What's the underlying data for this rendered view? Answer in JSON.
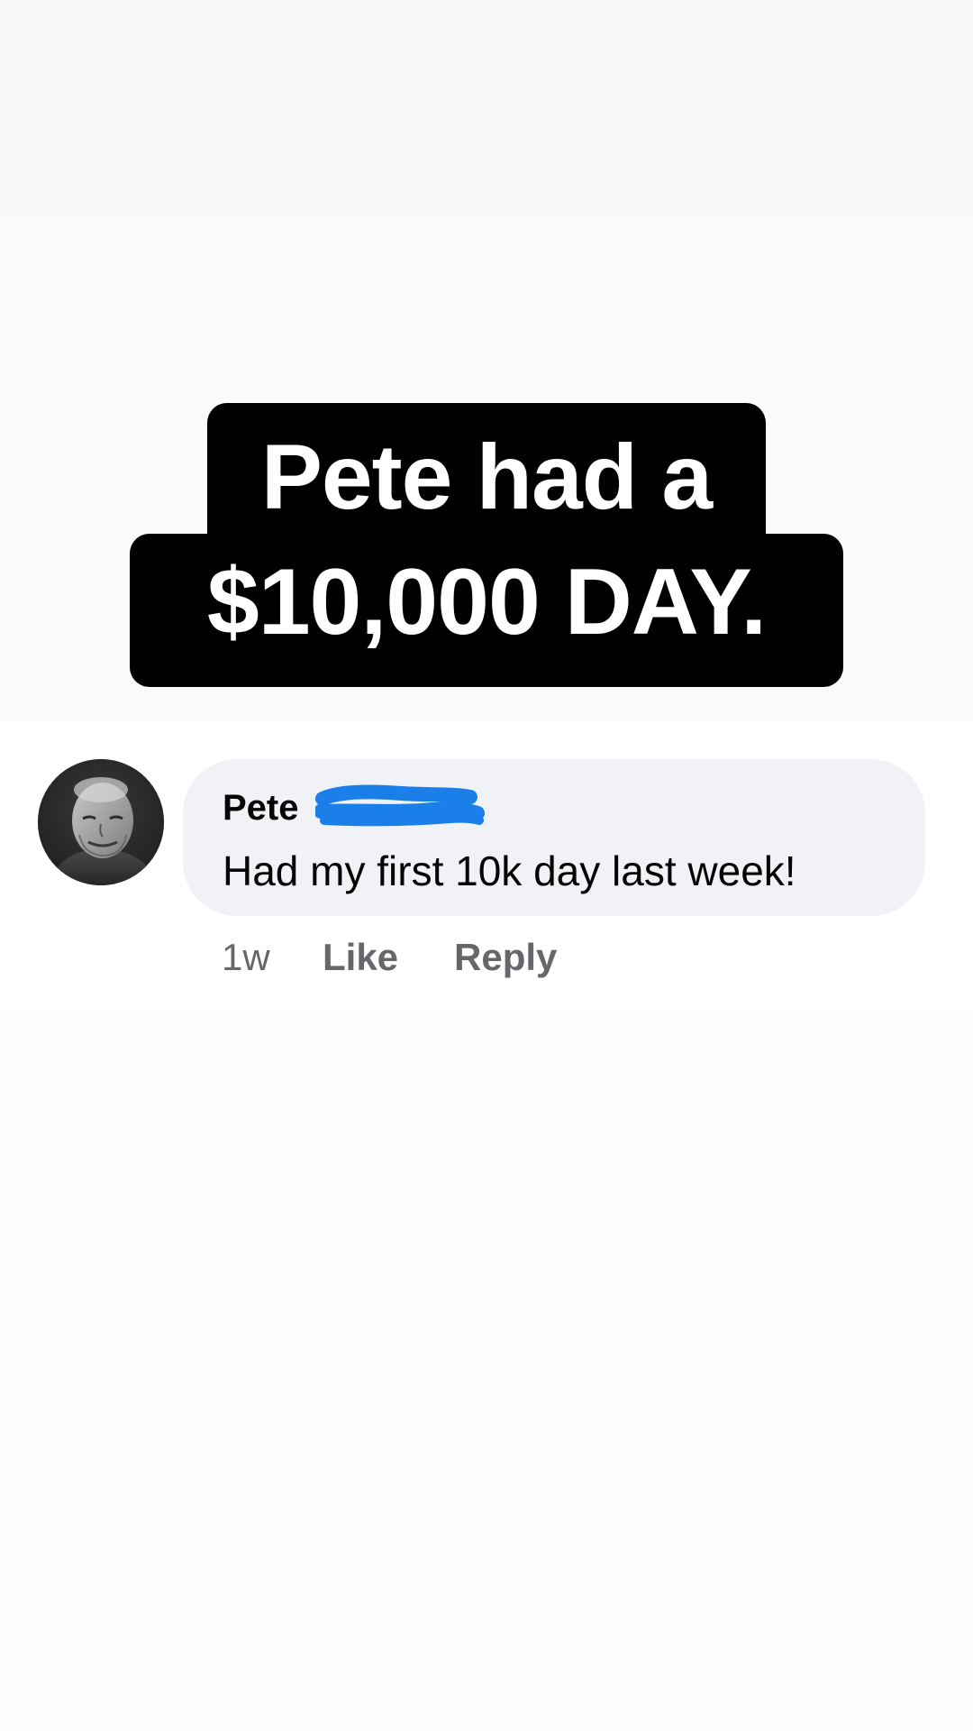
{
  "headline": {
    "line1": "Pete had a",
    "line2": "$10,000 DAY."
  },
  "comment": {
    "author": "Pete",
    "text": "Had my first 10k day last week!",
    "time": "1w",
    "like_label": "Like",
    "reply_label": "Reply",
    "redaction_color": "#1877f2"
  },
  "colors": {
    "headline_background": "#000000",
    "headline_text": "#ffffff",
    "bubble_background": "#f0f2f5",
    "meta_text": "#65676b"
  }
}
